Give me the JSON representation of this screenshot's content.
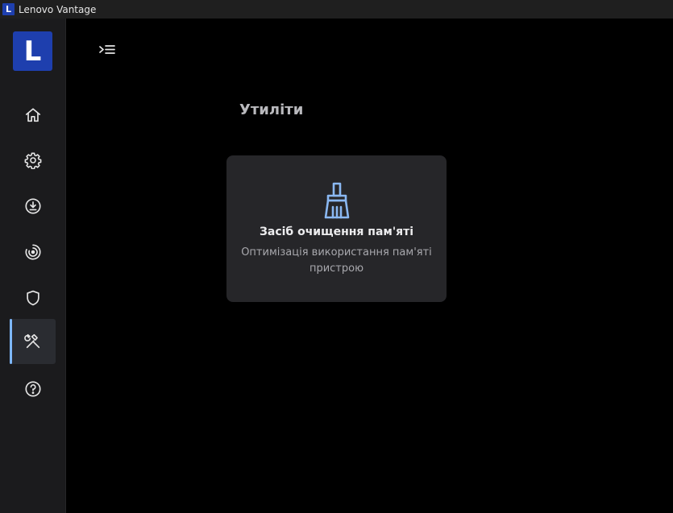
{
  "window": {
    "logo_letter": "L",
    "title": "Lenovo Vantage"
  },
  "sidebar": {
    "brand_letter": "L",
    "items": [
      {
        "icon": "home-icon"
      },
      {
        "icon": "gear-icon"
      },
      {
        "icon": "download-icon"
      },
      {
        "icon": "target-icon"
      },
      {
        "icon": "shield-icon"
      },
      {
        "icon": "tools-icon",
        "active": true
      },
      {
        "icon": "help-icon"
      }
    ]
  },
  "main": {
    "title": "Утиліти",
    "card": {
      "icon": "broom-icon",
      "title": "Засіб очищення пам'яті",
      "description": "Оптимізація використання пам'яті пристрою"
    }
  },
  "colors": {
    "accent": "#7eb8ff",
    "brand": "#1e3fae"
  }
}
